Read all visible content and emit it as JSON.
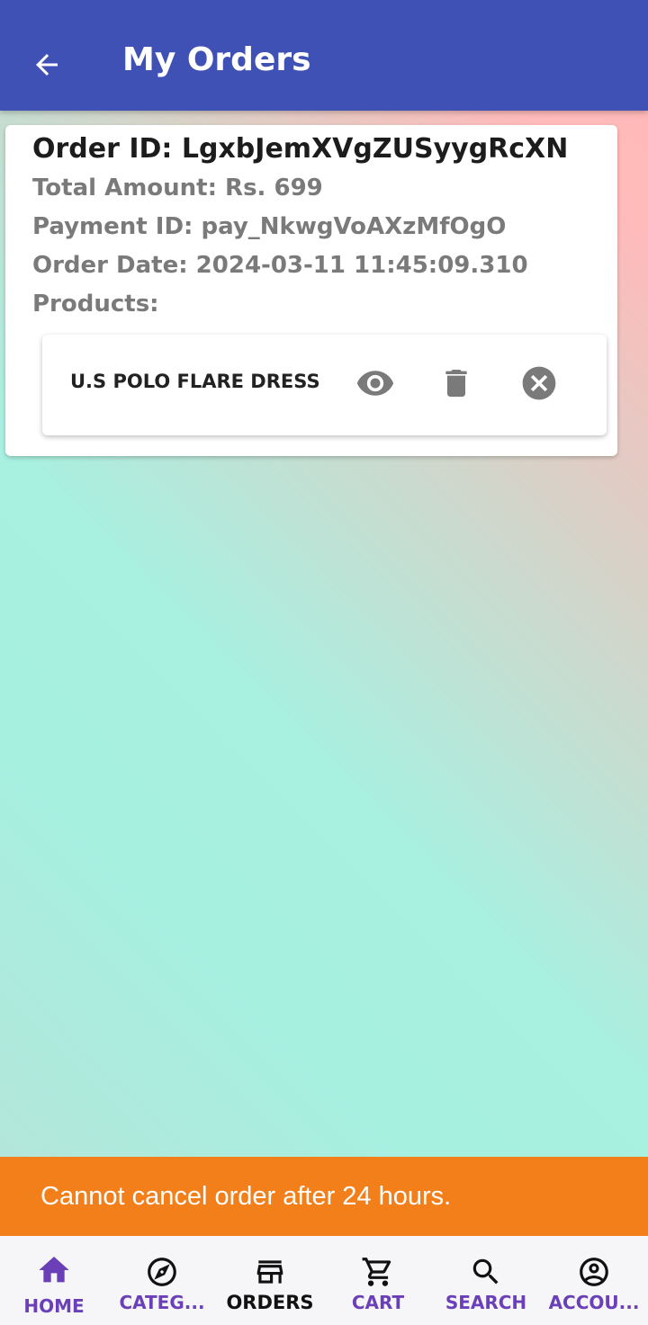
{
  "app_bar": {
    "title": "My Orders",
    "back_icon": "arrow-back-icon",
    "background": "#3f51b5"
  },
  "order": {
    "id_text": "Order ID: LgxbJemXVgZUSyygRcXN",
    "total_text": "Total Amount: Rs. 699",
    "payment_text": "Payment ID: pay_NkwgVoAXzMfOgO",
    "date_text": "Order Date: 2024-03-11 11:45:09.310",
    "products_label": "Products:",
    "products": [
      {
        "name": "U.S POLO FLARE DRESS",
        "icons": [
          "eye-icon",
          "trash-icon",
          "close-circle-icon"
        ]
      }
    ]
  },
  "snackbar": {
    "message": "Cannot cancel order after 24 hours.",
    "background": "#f37f1b"
  },
  "bottom_nav": {
    "items": [
      {
        "label": "HOME",
        "icon": "home-icon"
      },
      {
        "label": "CATEG...",
        "icon": "compass-icon"
      },
      {
        "label": "ORDERS",
        "icon": "store-icon",
        "active": true
      },
      {
        "label": "CART",
        "icon": "cart-icon"
      },
      {
        "label": "SEARCH",
        "icon": "search-icon"
      },
      {
        "label": "ACCOU...",
        "icon": "account-circle-icon"
      }
    ],
    "accent": "#6a3fb8"
  }
}
